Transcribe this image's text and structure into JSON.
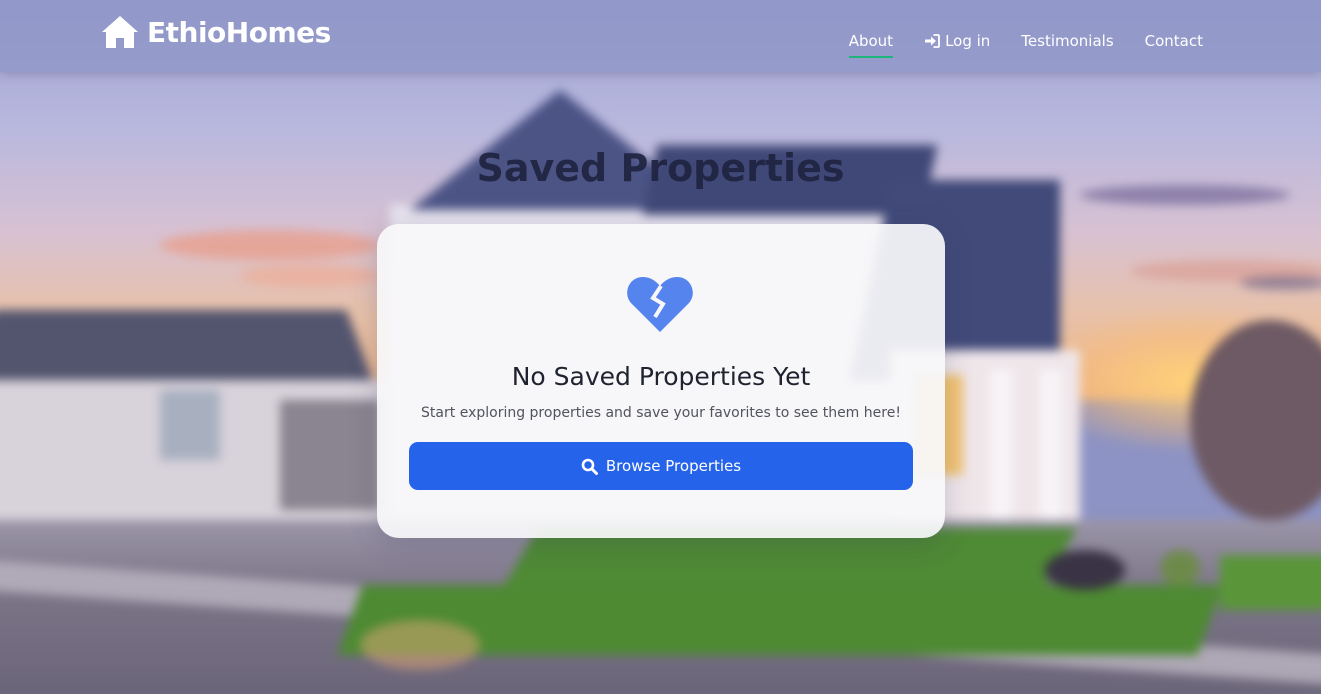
{
  "brand": {
    "name": "EthioHomes",
    "icon": "house-icon"
  },
  "nav": {
    "items": [
      {
        "label": "About",
        "active": true
      },
      {
        "label": "Log in",
        "icon": "sign-in-icon"
      },
      {
        "label": "Testimonials"
      },
      {
        "label": "Contact"
      }
    ],
    "active_underline_color": "#1db57a"
  },
  "page": {
    "title": "Saved Properties"
  },
  "empty_state": {
    "icon": "broken-heart-icon",
    "title": "No Saved Properties Yet",
    "message": "Start exploring properties and save your favorites to see them here!",
    "button": {
      "label": "Browse Properties",
      "icon": "search-icon"
    }
  },
  "colors": {
    "primary_button": "#2563eb",
    "heart_icon": "#5584ee",
    "navbar_bg": "#8c94c6"
  }
}
